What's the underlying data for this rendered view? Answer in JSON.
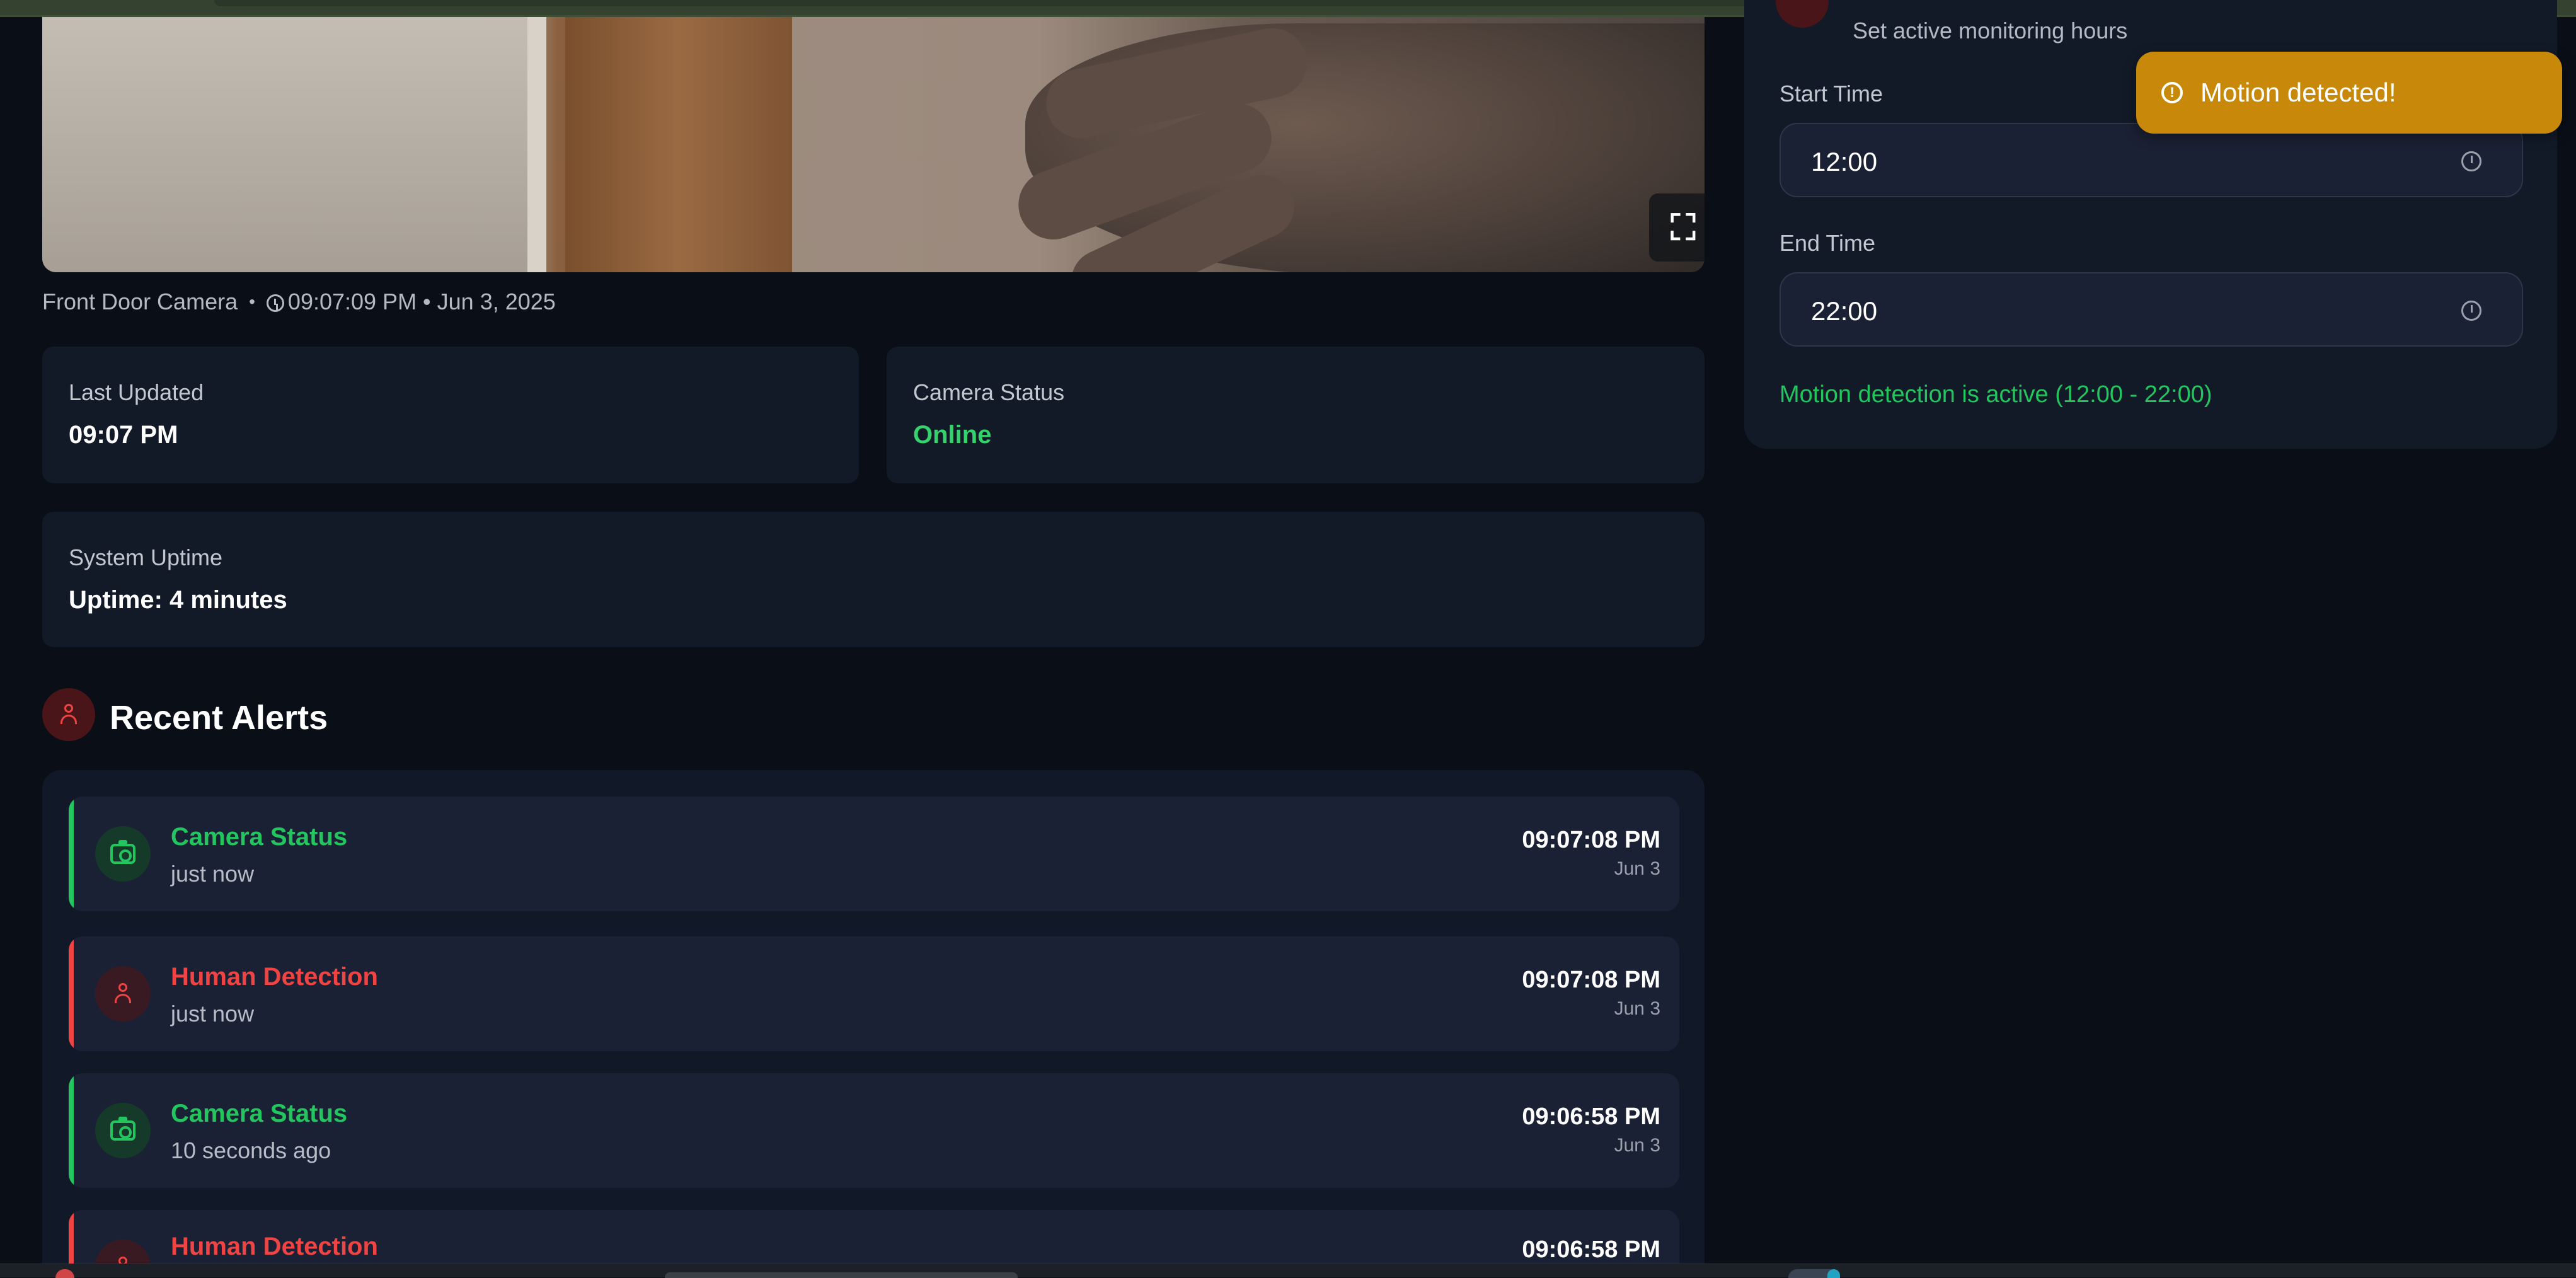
{
  "camera": {
    "name": "Front Door Camera",
    "separator": "•",
    "timestamp": "09:07:09 PM • Jun 3, 2025",
    "fullscreen_icon": "fullscreen-icon"
  },
  "stats": {
    "last_updated": {
      "label": "Last Updated",
      "value": "09:07 PM"
    },
    "camera_status": {
      "label": "Camera Status",
      "value": "Online",
      "color": "#34d36b"
    },
    "system_uptime": {
      "label": "System Uptime",
      "value": "Uptime: 4 minutes"
    }
  },
  "recent_alerts": {
    "title": "Recent Alerts",
    "icon": "person-icon",
    "items": [
      {
        "title": "Camera Status",
        "subtitle": "just now",
        "time": "09:07:08 PM",
        "date": "Jun 3",
        "type": "camera",
        "color": "#22c55e"
      },
      {
        "title": "Human Detection",
        "subtitle": "just now",
        "time": "09:07:08 PM",
        "date": "Jun 3",
        "type": "human",
        "color": "#ef4444"
      },
      {
        "title": "Camera Status",
        "subtitle": "10 seconds ago",
        "time": "09:06:58 PM",
        "date": "Jun 3",
        "type": "camera",
        "color": "#22c55e"
      },
      {
        "title": "Human Detection",
        "subtitle": "",
        "time": "09:06:58 PM",
        "date": "",
        "type": "human",
        "color": "#ef4444"
      }
    ]
  },
  "schedule": {
    "subtitle": "Set active monitoring hours",
    "start_label": "Start Time",
    "start_value": "12:00",
    "end_label": "End Time",
    "end_value": "22:00",
    "status": "Motion detection is active (12:00 - 22:00)"
  },
  "toast": {
    "message": "Motion detected!",
    "icon": "alert-circle-icon",
    "color": "#c8890a"
  }
}
